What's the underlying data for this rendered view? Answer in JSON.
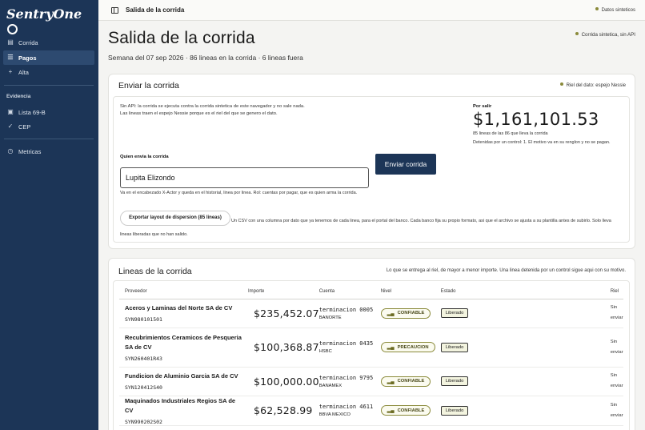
{
  "sidebar": {
    "logo": "SentryOne",
    "items": [
      {
        "label": "Corrida",
        "icon": "document-icon"
      },
      {
        "label": "Pagos",
        "icon": "list-icon"
      },
      {
        "label": "Alta",
        "icon": "plus-icon"
      }
    ],
    "section": "Evidencia",
    "evidence": [
      {
        "label": "Lista 69-B",
        "icon": "clipboard-icon"
      },
      {
        "label": "CEP",
        "icon": "check-circle-icon"
      }
    ],
    "footer": [
      {
        "label": "Metricas",
        "icon": "clock-icon"
      }
    ]
  },
  "topbar": {
    "breadcrumb": "Salida de la corrida",
    "status": "Datos sinteticos"
  },
  "page": {
    "title": "Salida de la corrida",
    "subtitle": "Semana del 07 sep 2026 · 86 lineas en la corrida · 6 lineas fuera",
    "tag": "Corrida sintetica, sin API"
  },
  "send": {
    "title": "Enviar la corrida",
    "tag": "Riel del dato: espejo Nessie",
    "desc": "Sin API: la corrida se ejecuta contra la corrida sintetica de este navegador y no sale nada. Las lineas traen el espejo Nessie porque es el riel del que se genero el dato.",
    "amount_label": "Por salir",
    "amount": "$1,161,101.53",
    "amount_note": "85 lineas de las 86 que lleva la corrida",
    "amount_note2": "Detenidas por un control: 1. El motivo va en su renglon y no se pagan.",
    "who_label": "Quien envia la corrida",
    "who_value": "Lupita Elizondo",
    "send_button": "Enviar corrida",
    "who_help": "Va en el encabezado X-Actor y queda en el historial, linea por linea. Rol: cuentas por pagar, que es quien arma la corrida.",
    "export_button": "Exportar layout de dispersion (85 lineas)",
    "export_help": "Un CSV con una columna por dato que ya tenemos de cada linea, para el portal del banco. Cada banco fija su propio formato, asi que el archivo se ajusta a su plantilla antes de subirlo. Solo lleva lineas liberadas que no han salido."
  },
  "lines": {
    "title": "Lineas de la corrida",
    "tag": "Lo que se entrega al riel, de mayor a menor importe. Una linea detenida por un control sigue aqui con su motivo.",
    "headers": [
      "Proveedor",
      "Importe",
      "Cuenta",
      "Nivel",
      "Estado",
      "Riel"
    ],
    "rows": [
      {
        "name": "Aceros y Laminas del Norte SA de CV",
        "rfc": "SYN980101501",
        "amount": "$235,452.07",
        "account": "terminacion 0005",
        "bank": "BANORTE",
        "level": "CONFIABLE",
        "status": "Liberado",
        "riel1": "Sin",
        "riel2": "enviar"
      },
      {
        "name": "Recubrimientos Ceramicos de Pesqueria SA de CV",
        "rfc": "SYN260401R43",
        "amount": "$100,368.87",
        "account": "terminacion 0435",
        "bank": "HSBC",
        "level": "PRECAUCION",
        "status": "Liberado",
        "riel1": "Sin",
        "riel2": "enviar"
      },
      {
        "name": "Fundicion de Aluminio Garcia SA de CV",
        "rfc": "SYN120412S40",
        "amount": "$100,000.00",
        "account": "terminacion 9795",
        "bank": "BANAMEX",
        "level": "CONFIABLE",
        "status": "Liberado",
        "riel1": "Sin",
        "riel2": "enviar"
      },
      {
        "name": "Maquinados Industriales Regios SA de CV",
        "rfc": "SYN990202S02",
        "amount": "$62,528.99",
        "account": "terminacion 4611",
        "bank": "BBVA MEXICO",
        "level": "CONFIABLE",
        "status": "Liberado",
        "riel1": "Sin",
        "riel2": "enviar"
      }
    ]
  }
}
